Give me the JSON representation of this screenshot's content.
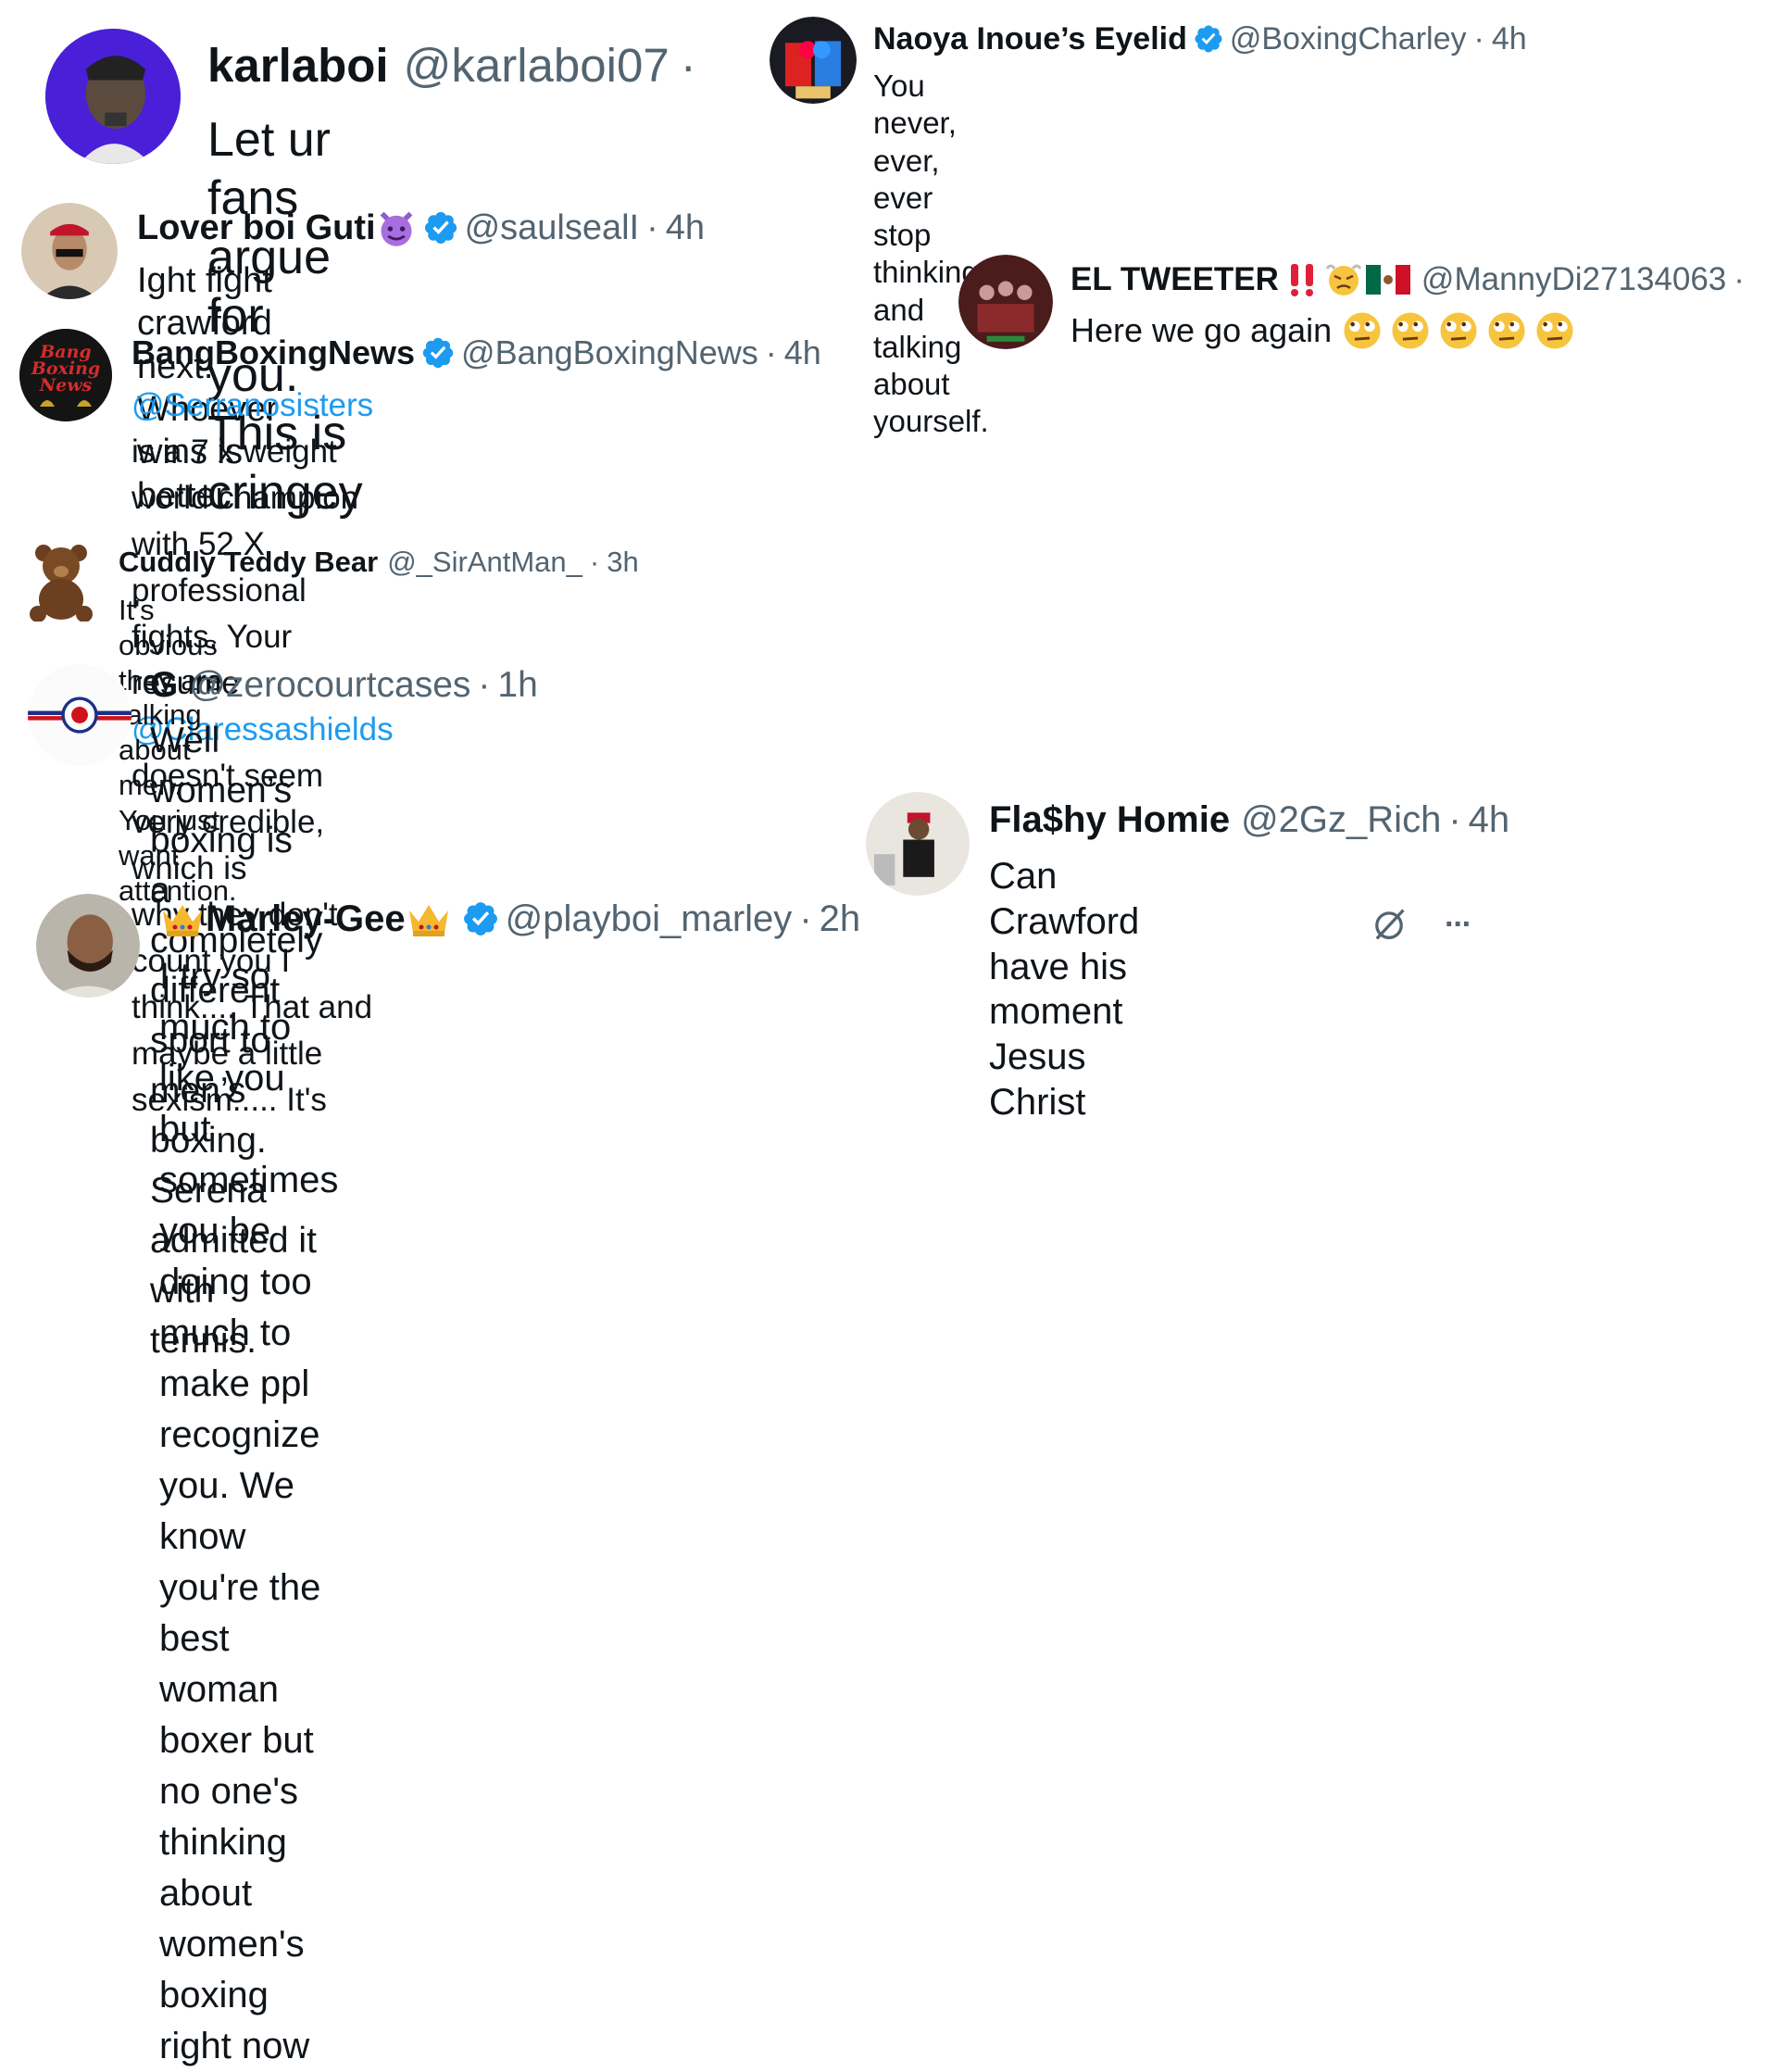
{
  "tweets": {
    "karla": {
      "name": "karlaboi",
      "handle": "@karlaboi07",
      "dot": "·",
      "time": "",
      "text": "Let ur fans argue for you. This is cringey"
    },
    "naoya": {
      "name": "Naoya Inoue’s Eyelid",
      "handle": "@BoxingCharley",
      "dot": "·",
      "time": "4h",
      "text": "You never, ever, ever stop thinking and talking about yourself."
    },
    "guti": {
      "name": "Lover boi Guti",
      "handle": "@saulsealI",
      "dot": "·",
      "time": "4h",
      "text": "Ight fight crawford next. Whoever wins is better"
    },
    "tweeter": {
      "name": "EL TWEETER",
      "handle": "@MannyDi27134063",
      "dot": "·",
      "time": "",
      "text": "Here we go again"
    },
    "bang": {
      "name": "BangBoxingNews",
      "handle": "@BangBoxingNews",
      "dot": "·",
      "time": "4h",
      "mention1": "@Serranosisters",
      "t1": " is a 7 x weight world champion with 52 X professional",
      "t2": "fights. Your resume ",
      "mention2": "@Claressashields",
      "t3": " doesn't seem very credible, which is",
      "t4": "why they don't count you I think.... That and maybe a little sexism..... It's",
      "logo_text": "Bang Boxing News"
    },
    "teddy": {
      "name": "Cuddly Teddy Bear",
      "handle": "@_SirAntMan_",
      "dot": "·",
      "time": "3h",
      "text": "It's obvious they are talking about men. You just want attention."
    },
    "g": {
      "name": "G",
      "handle": "@zerocourtcases",
      "dot": "·",
      "time": "1h",
      "line1": "Well women’s boxing is a completely different sport to men’s boxing.",
      "line2": "Serena admitted it with tennis."
    },
    "flashy": {
      "name": "Fla$hy Homie",
      "handle": "@2Gz_Rich",
      "dot": "·",
      "time": "4h",
      "text": "Can Crawford have his moment Jesus Christ"
    },
    "marley": {
      "name": "Marley-Gee",
      "handle": "@playboi_marley",
      "dot": "·",
      "time": "2h",
      "line1": "I try so much to like you but sometimes you be doing too much to make ppl",
      "line2": "recognize you. We know you're the best woman boxer but no one's thinking",
      "line3": "about women's boxing right now",
      "more": "···"
    }
  },
  "colors": {
    "text": "#0f1419",
    "muted": "#536471",
    "link": "#1d9bf0",
    "verified": "#1d9bf0"
  },
  "icons": [
    "verified-badge-icon",
    "devil-emoji-icon",
    "double-exclamation-icon",
    "angry-emoji-icon",
    "mexico-flag-icon",
    "rolling-eyes-emoji-icon",
    "crown-emoji-icon",
    "grok-icon",
    "more-icon"
  ]
}
